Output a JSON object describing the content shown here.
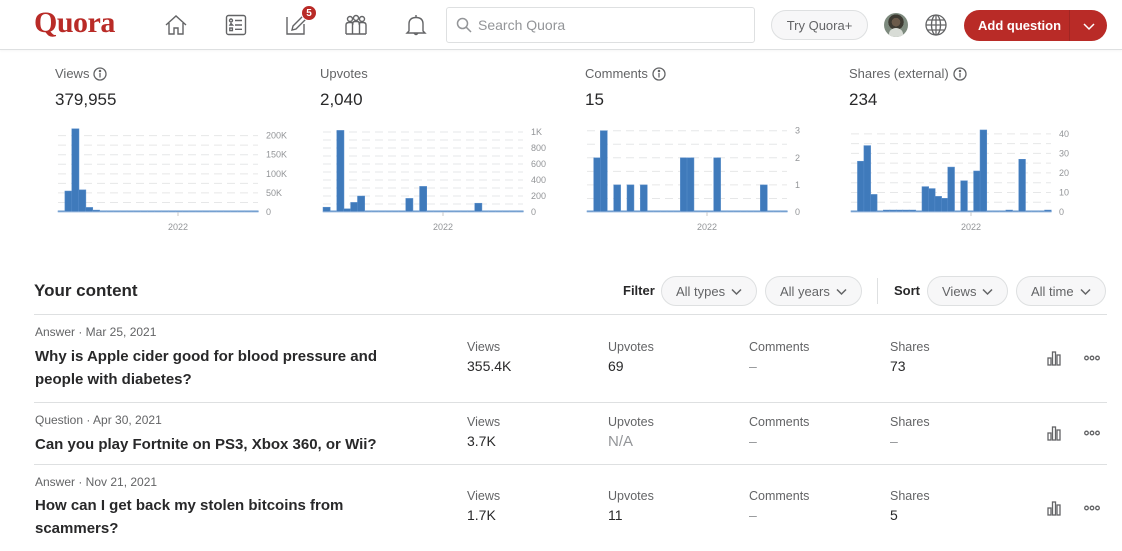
{
  "header": {
    "logo": "Quora",
    "nav": [
      {
        "name": "home",
        "icon": "home-icon"
      },
      {
        "name": "following",
        "icon": "list-icon"
      },
      {
        "name": "answer",
        "icon": "edit-icon",
        "badge": "5"
      },
      {
        "name": "spaces",
        "icon": "people-icon"
      },
      {
        "name": "notifications",
        "icon": "bell-icon"
      }
    ],
    "search_placeholder": "Search Quora",
    "try_plus_label": "Try Quora+",
    "add_question_label": "Add question",
    "accent_color": "#b92b27"
  },
  "stats": [
    {
      "label": "Views",
      "value": "379,955",
      "has_info": true
    },
    {
      "label": "Upvotes",
      "value": "2,040",
      "has_info": false
    },
    {
      "label": "Comments",
      "value": "15",
      "has_info": true
    },
    {
      "label": "Shares (external)",
      "value": "234",
      "has_info": true
    }
  ],
  "chart_data": [
    {
      "type": "bar",
      "title": "Views",
      "xlabel": "2022",
      "y_ticks": [
        "0",
        "50K",
        "100K",
        "150K",
        "200K"
      ],
      "y_tick_values": [
        0,
        50000,
        100000,
        150000,
        200000
      ],
      "ylim": [
        0,
        220000
      ],
      "x_tick_label": "2022",
      "x_tick_position": 0.6,
      "grid": true,
      "values": [
        2000,
        55000,
        218000,
        58000,
        12000,
        5000,
        2000,
        2000,
        2000,
        500,
        500,
        500,
        500,
        500,
        2000,
        2000,
        2000,
        2000,
        500,
        3000,
        1000,
        1000,
        1000,
        1000,
        1000,
        1000,
        1000,
        1000,
        1000
      ]
    },
    {
      "type": "bar",
      "title": "Upvotes",
      "xlabel": "2022",
      "y_ticks": [
        "0",
        "200",
        "400",
        "600",
        "800",
        "1K"
      ],
      "y_tick_values": [
        0,
        200,
        400,
        600,
        800,
        1000
      ],
      "ylim": [
        0,
        1050
      ],
      "x_tick_label": "2022",
      "x_tick_position": 0.6,
      "grid": true,
      "values": [
        60,
        15,
        1020,
        40,
        120,
        200,
        5,
        5,
        5,
        5,
        5,
        5,
        170,
        5,
        320,
        5,
        5,
        5,
        5,
        5,
        5,
        5,
        110,
        5,
        5,
        5,
        5,
        5,
        5
      ]
    },
    {
      "type": "bar",
      "title": "Comments",
      "xlabel": "2022",
      "y_ticks": [
        "0",
        "1",
        "2",
        "3"
      ],
      "y_tick_values": [
        0,
        1,
        2,
        3
      ],
      "ylim": [
        0,
        3.1
      ],
      "x_tick_label": "2022",
      "x_tick_position": 0.6,
      "grid": true,
      "values": [
        0,
        2,
        3,
        0,
        1,
        0,
        1,
        0,
        1,
        0,
        0,
        0,
        0,
        0,
        2,
        2,
        0,
        0,
        0,
        2,
        0,
        0,
        0,
        0,
        0,
        0,
        1,
        0,
        0,
        0
      ]
    },
    {
      "type": "bar",
      "title": "Shares (external)",
      "xlabel": "2022",
      "y_ticks": [
        "0",
        "10",
        "20",
        "30",
        "40"
      ],
      "y_tick_values": [
        0,
        10,
        20,
        30,
        40
      ],
      "ylim": [
        0,
        43
      ],
      "x_tick_label": "2022",
      "x_tick_position": 0.6,
      "grid": true,
      "values": [
        0,
        26,
        34,
        9,
        0,
        1,
        1,
        1,
        1,
        1,
        0,
        13,
        12,
        8,
        7,
        23,
        0,
        16,
        0,
        21,
        42,
        0,
        0,
        0,
        1,
        0,
        27,
        0,
        0,
        0,
        1
      ]
    }
  ],
  "content": {
    "title": "Your content",
    "filter_label": "Filter",
    "filter_type": "All types",
    "filter_year": "All years",
    "sort_label": "Sort",
    "sort_by": "Views",
    "sort_time": "All time",
    "metric_labels": {
      "views": "Views",
      "upvotes": "Upvotes",
      "comments": "Comments",
      "shares": "Shares"
    },
    "rows": [
      {
        "meta": "Answer · Mar 25, 2021",
        "title": "Why is Apple cider good for blood pressure and people with diabetes?",
        "views": "355.4K",
        "upvotes": "69",
        "comments": "–",
        "shares": "73"
      },
      {
        "meta": "Question · Apr 30, 2021",
        "title": "Can you play Fortnite on PS3, Xbox 360, or Wii?",
        "views": "3.7K",
        "upvotes": "N/A",
        "comments": "–",
        "shares": "–"
      },
      {
        "meta": "Answer · Nov 21, 2021",
        "title": "How can I get back my stolen bitcoins from scammers?",
        "views": "1.7K",
        "upvotes": "11",
        "comments": "–",
        "shares": "5"
      }
    ]
  }
}
